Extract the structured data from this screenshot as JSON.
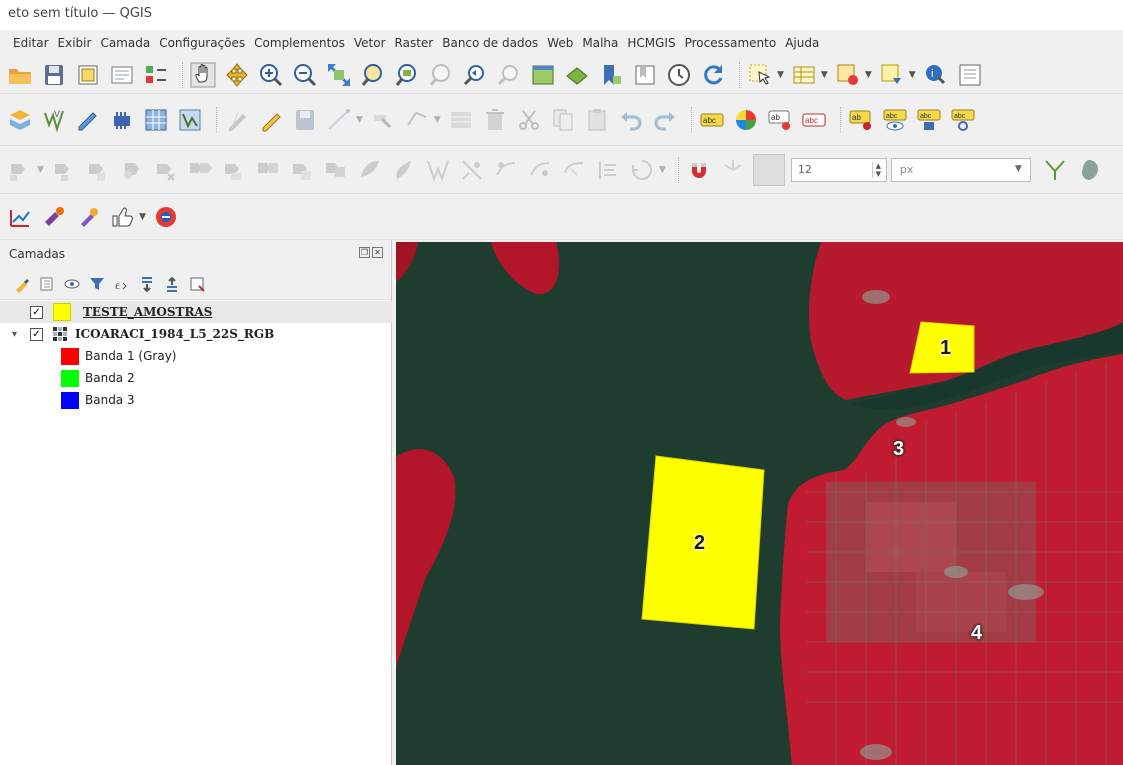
{
  "window": {
    "title": "eto sem título — QGIS"
  },
  "menu": [
    "Editar",
    "Exibir",
    "Camada",
    "Configurações",
    "Complementos",
    "Vetor",
    "Raster",
    "Banco de dados",
    "Web",
    "Malha",
    "HCMGIS",
    "Processamento",
    "Ajuda"
  ],
  "toolbar3": {
    "spin_value": "12",
    "unit_value": "px"
  },
  "layers_panel": {
    "title": "Camadas",
    "layers": [
      {
        "name": "TESTE_AMOSTRAS",
        "checked": "✓",
        "color": "#ffff00"
      },
      {
        "name": "ICOARACI_1984_L5_22S_RGB",
        "checked": "✓",
        "expander": "▾"
      }
    ],
    "bands": [
      {
        "name": "Banda 1 (Gray)",
        "color": "#ff0000"
      },
      {
        "name": "Banda 2",
        "color": "#00ff00"
      },
      {
        "name": "Banda 3",
        "color": "#0000ff"
      }
    ]
  },
  "map": {
    "sample_labels": [
      "1",
      "2",
      "3",
      "4"
    ],
    "colors": {
      "water": "#1e3a2c",
      "vegetation": "#c8102e",
      "samples": "#ffff00"
    }
  }
}
